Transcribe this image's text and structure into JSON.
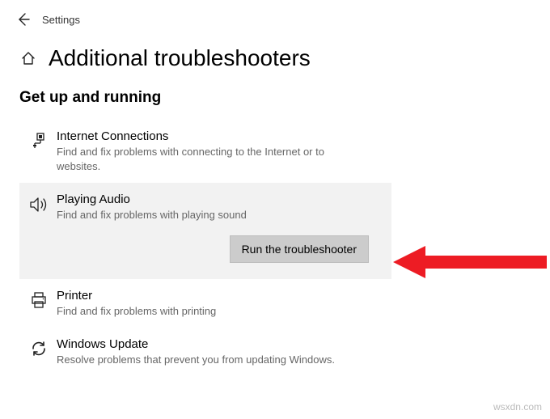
{
  "topbar": {
    "title": "Settings"
  },
  "page": {
    "title": "Additional troubleshooters"
  },
  "section": {
    "title": "Get up and running"
  },
  "items": [
    {
      "title": "Internet Connections",
      "desc": "Find and fix problems with connecting to the Internet or to websites."
    },
    {
      "title": "Playing Audio",
      "desc": "Find and fix problems with playing sound"
    },
    {
      "title": "Printer",
      "desc": "Find and fix problems with printing"
    },
    {
      "title": "Windows Update",
      "desc": "Resolve problems that prevent you from updating Windows."
    }
  ],
  "buttons": {
    "run": "Run the troubleshooter"
  },
  "watermark": "wsxdn.com"
}
